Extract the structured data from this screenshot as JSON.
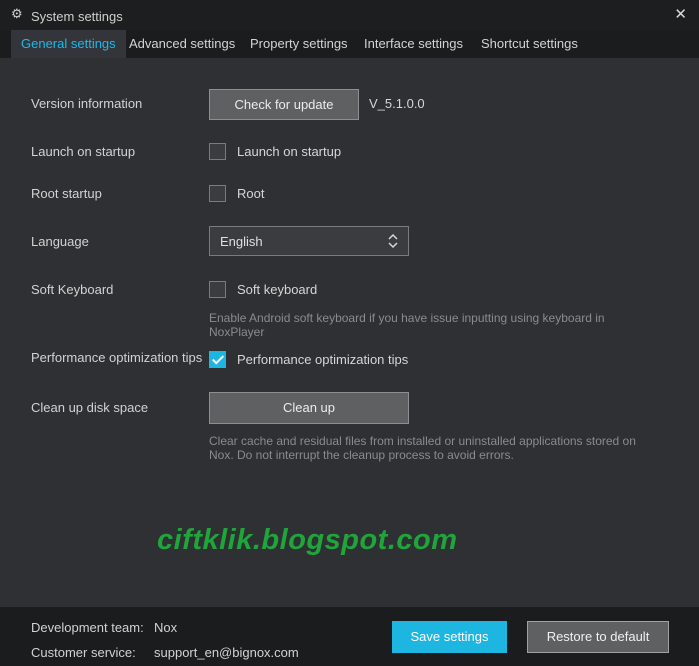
{
  "window": {
    "title": "System settings",
    "settings_icon": "gear-icon",
    "close_icon": "close-icon",
    "close_glyph": "✕"
  },
  "tabs": [
    {
      "label": "General settings",
      "active": true
    },
    {
      "label": "Advanced settings",
      "active": false
    },
    {
      "label": "Property settings",
      "active": false
    },
    {
      "label": "Interface settings",
      "active": false
    },
    {
      "label": "Shortcut settings",
      "active": false
    }
  ],
  "general": {
    "version": {
      "label": "Version information",
      "button": "Check for update",
      "value": "V_5.1.0.0"
    },
    "launch": {
      "label": "Launch on startup",
      "checkbox_label": "Launch on startup",
      "checked": false
    },
    "root": {
      "label": "Root startup",
      "checkbox_label": "Root",
      "checked": false
    },
    "language": {
      "label": "Language",
      "selected": "English"
    },
    "soft_keyboard": {
      "label": "Soft Keyboard",
      "checkbox_label": "Soft keyboard",
      "checked": false,
      "hint_line1": "Enable Android soft keyboard if you have issue inputting using keyboard in",
      "hint_line2": "NoxPlayer"
    },
    "perf": {
      "label": "Performance optimization tips",
      "checkbox_label": "Performance optimization tips",
      "checked": true
    },
    "cleanup": {
      "label": "Clean up disk space",
      "button": "Clean up",
      "hint_line1": "Clear cache and residual files from installed or uninstalled applications stored on",
      "hint_line2": "Nox. Do not interrupt the cleanup process to avoid errors."
    }
  },
  "watermark": "ciftklik.blogspot.com",
  "footer": {
    "dev_label": "Development team:",
    "dev_value": "Nox",
    "support_label": "Customer service:",
    "support_value": "support_en@bignox.com",
    "save_button": "Save settings",
    "restore_button": "Restore to default"
  },
  "colors": {
    "accent": "#1cb6e0",
    "panel_bg": "#2e3033",
    "window_bg": "#1b1c1e",
    "watermark": "#1fa53a"
  }
}
